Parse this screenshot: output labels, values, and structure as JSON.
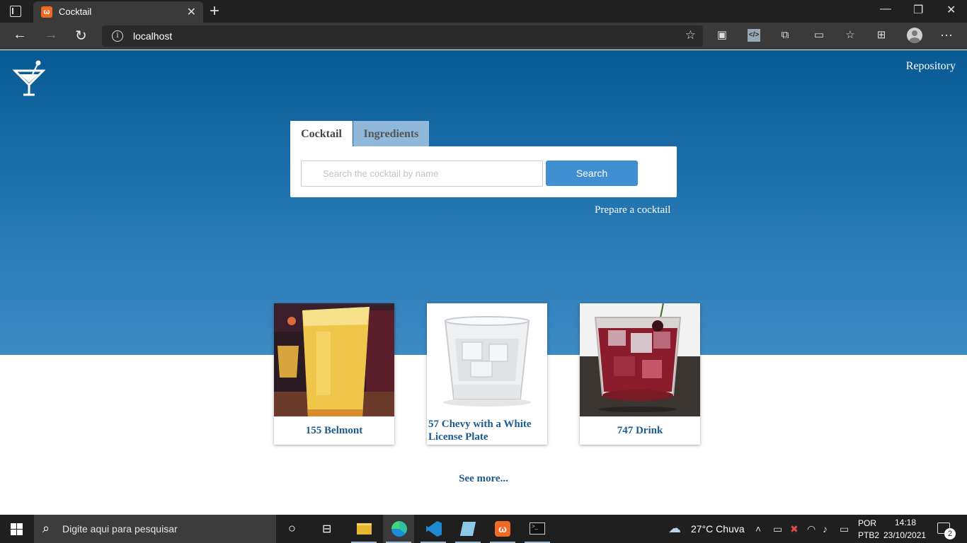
{
  "browser": {
    "tab_title": "Cocktail",
    "url": "localhost",
    "window_controls": [
      "minimize-icon",
      "restore-icon",
      "close-icon"
    ]
  },
  "header": {
    "logo": "martini-glass-icon",
    "repository_link": "Repository"
  },
  "search": {
    "tabs": [
      "Cocktail",
      "Ingredients"
    ],
    "active_tab": "Cocktail",
    "input_value": "",
    "input_placeholder": "Search the cocktail by name",
    "button_label": "Search",
    "prepare_link": "Prepare a cocktail"
  },
  "cocktails": [
    {
      "name": "155 Belmont",
      "image": "orange-drink-photo"
    },
    {
      "name": "57 Chevy with a White License Plate",
      "image": "clear-drink-photo"
    },
    {
      "name": "747 Drink",
      "image": "red-drink-photo"
    }
  ],
  "see_more": "See more...",
  "taskbar": {
    "search_placeholder": "Digite aqui para pesquisar",
    "weather": "27°C  Chuva",
    "language": "POR",
    "layout": "PTB2",
    "time": "14:18",
    "date": "23/10/2021",
    "notifications": "2"
  },
  "colors": {
    "hero_top": "#085a95",
    "hero_bottom": "#3d8ac4",
    "search_button": "#3f8fd2",
    "link_text": "#1b5b8f",
    "inactive_tab": "#8fb8db"
  }
}
